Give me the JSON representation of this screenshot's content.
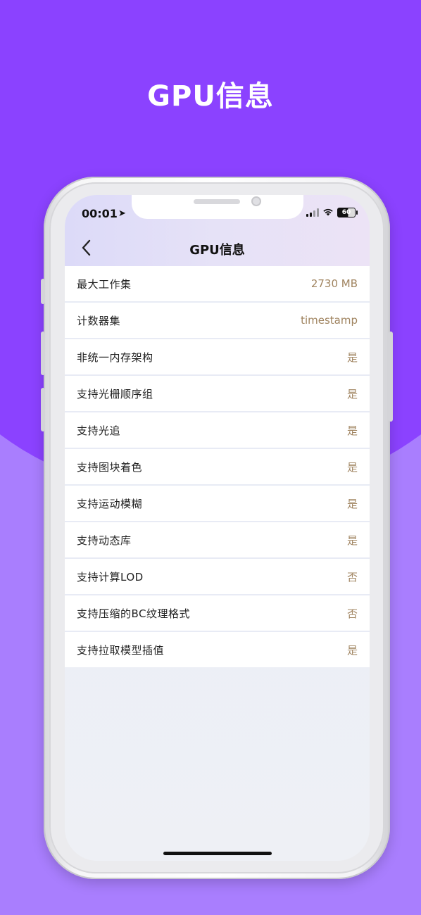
{
  "promo": {
    "title": "GPU信息"
  },
  "status_bar": {
    "time": "00:01",
    "location_icon": "location-arrow-icon",
    "battery": "60"
  },
  "nav": {
    "title": "GPU信息",
    "back_icon": "chevron-left-icon"
  },
  "rows": [
    {
      "label": "最大工作集",
      "value": "2730 MB"
    },
    {
      "label": "计数器集",
      "value": "timestamp"
    },
    {
      "label": "非统一内存架构",
      "value": "是"
    },
    {
      "label": "支持光栅顺序组",
      "value": "是"
    },
    {
      "label": "支持光追",
      "value": "是"
    },
    {
      "label": "支持图块着色",
      "value": "是"
    },
    {
      "label": "支持运动模糊",
      "value": "是"
    },
    {
      "label": "支持动态库",
      "value": "是"
    },
    {
      "label": "支持计算LOD",
      "value": "否"
    },
    {
      "label": "支持压缩的BC纹理格式",
      "value": "否"
    },
    {
      "label": "支持拉取模型插值",
      "value": "是"
    }
  ],
  "colors": {
    "background_top": "#8b42ff",
    "background_bottom": "#a97efe",
    "value_text": "#a08460"
  }
}
